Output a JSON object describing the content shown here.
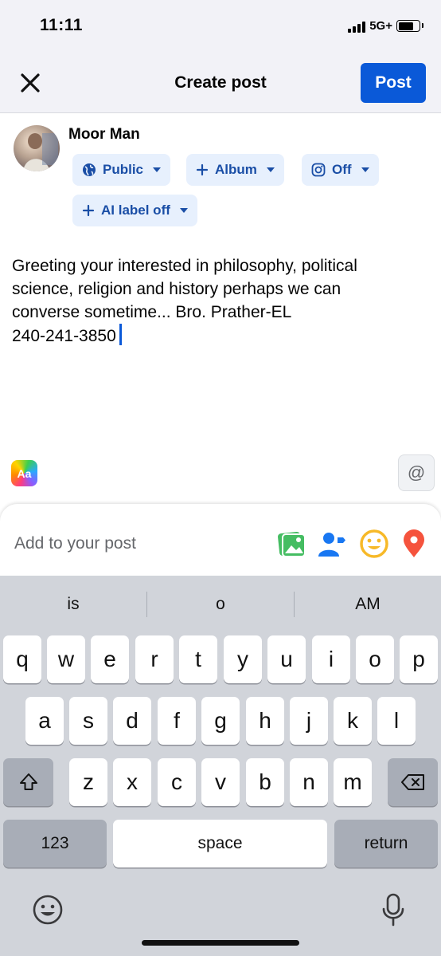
{
  "status_bar": {
    "time": "11:11",
    "network": "5G+"
  },
  "header": {
    "title": "Create post",
    "post_label": "Post"
  },
  "composer": {
    "user_name": "Moor Man",
    "chips": {
      "audience": "Public",
      "album": "Album",
      "instagram": "Off",
      "ai_label": "AI label off"
    },
    "text_lines": [
      "Greeting your interested in philosophy, political",
      "science, religion and history perhaps we can",
      "converse sometime... Bro. Prather-EL",
      "240-241-3850"
    ],
    "aa_label": "Aa",
    "mention_label": "@"
  },
  "add_to_post": {
    "label": "Add to your post",
    "icons": [
      "photo-icon",
      "tag-people-icon",
      "feeling-icon",
      "location-icon"
    ]
  },
  "keyboard": {
    "suggestions": [
      "is",
      "o",
      "AM"
    ],
    "row1": [
      "q",
      "w",
      "e",
      "r",
      "t",
      "y",
      "u",
      "i",
      "o",
      "p"
    ],
    "row2": [
      "a",
      "s",
      "d",
      "f",
      "g",
      "h",
      "j",
      "k",
      "l"
    ],
    "row3": [
      "z",
      "x",
      "c",
      "v",
      "b",
      "n",
      "m"
    ],
    "numbers_label": "123",
    "space_label": "space",
    "return_label": "return"
  },
  "colors": {
    "accent": "#0a59d8",
    "chip_bg": "#e7f0fd",
    "chip_text": "#1a4ea6",
    "keyboard_bg": "#d1d4da"
  }
}
